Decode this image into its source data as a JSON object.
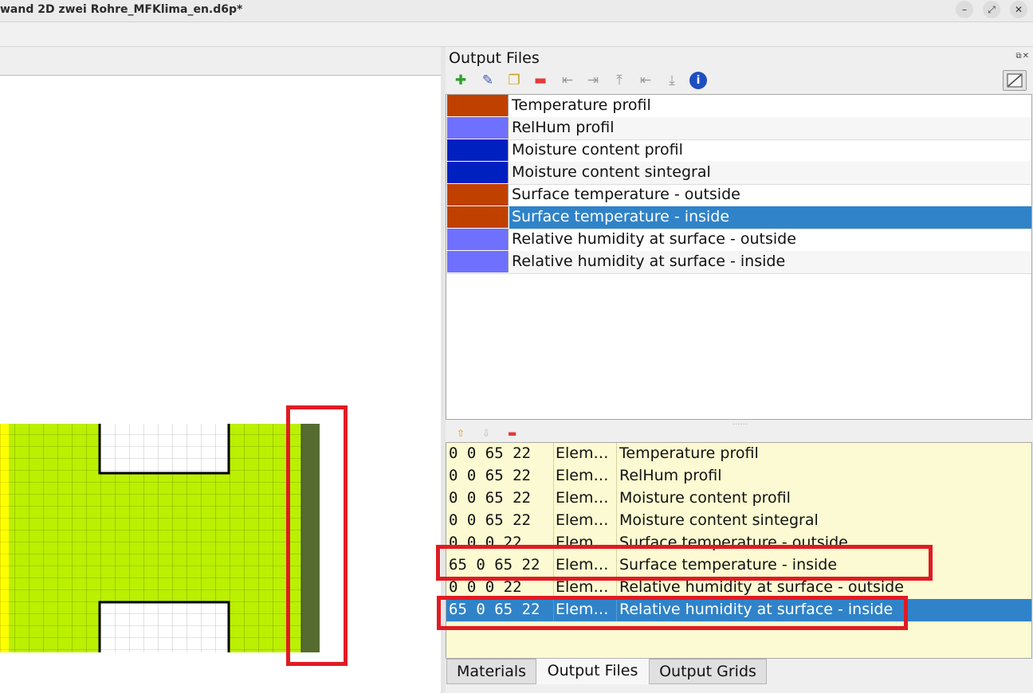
{
  "window": {
    "title": "wand 2D zwei Rohre_MFKlima_en.d6p*",
    "buttons": [
      "–",
      "⤢",
      "✕"
    ]
  },
  "dock": {
    "title": "Output Files",
    "toolbar_icons": [
      "add-icon",
      "edit-icon",
      "copy-icon",
      "remove-icon",
      "move-icon",
      "assign-right-icon",
      "assign-top-icon",
      "assign-left-icon",
      "assign-bottom-icon",
      "info-icon"
    ],
    "colors": {
      "selection": "#3083c8",
      "highlight": "#e01b24",
      "table_bg": "#fbfad2"
    }
  },
  "output_files": [
    {
      "name": "Temperature profil",
      "color": "#c04000"
    },
    {
      "name": "RelHum profil",
      "color": "#7070ff"
    },
    {
      "name": "Moisture content profil",
      "color": "#0020c0"
    },
    {
      "name": "Moisture content sintegral",
      "color": "#0020c0"
    },
    {
      "name": "Surface temperature - outside",
      "color": "#c04000"
    },
    {
      "name": "Surface temperature - inside",
      "color": "#c04000",
      "selected": true
    },
    {
      "name": "Relative humidity at surface - outside",
      "color": "#7070ff"
    },
    {
      "name": "Relative humidity at surface - inside",
      "color": "#7070ff"
    }
  ],
  "assignments": [
    {
      "coords": "0 0 65 22",
      "type": "Elem…",
      "name": "Temperature profil"
    },
    {
      "coords": "0 0 65 22",
      "type": "Elem…",
      "name": "RelHum profil"
    },
    {
      "coords": "0 0 65 22",
      "type": "Elem…",
      "name": "Moisture content profil"
    },
    {
      "coords": "0 0 65 22",
      "type": "Elem…",
      "name": "Moisture content sintegral"
    },
    {
      "coords": "0 0 0 22",
      "type": "Elem…",
      "name": "Surface temperature - outside"
    },
    {
      "coords": "65 0 65 22",
      "type": "Elem…",
      "name": "Surface temperature - inside"
    },
    {
      "coords": "0 0 0 22",
      "type": "Elem…",
      "name": "Relative humidity at surface - outside"
    },
    {
      "coords": "65 0 65 22",
      "type": "Elem…",
      "name": "Relative humidity at surface - inside",
      "selected": true
    }
  ],
  "tabs": [
    {
      "label": "Materials"
    },
    {
      "label": "Output Files",
      "active": true
    },
    {
      "label": "Output Grids"
    }
  ],
  "grid_colors": {
    "outside": "#ffff00",
    "wall": "#bbf000",
    "pipe": "#ffffff",
    "interior": "#556b2f"
  }
}
